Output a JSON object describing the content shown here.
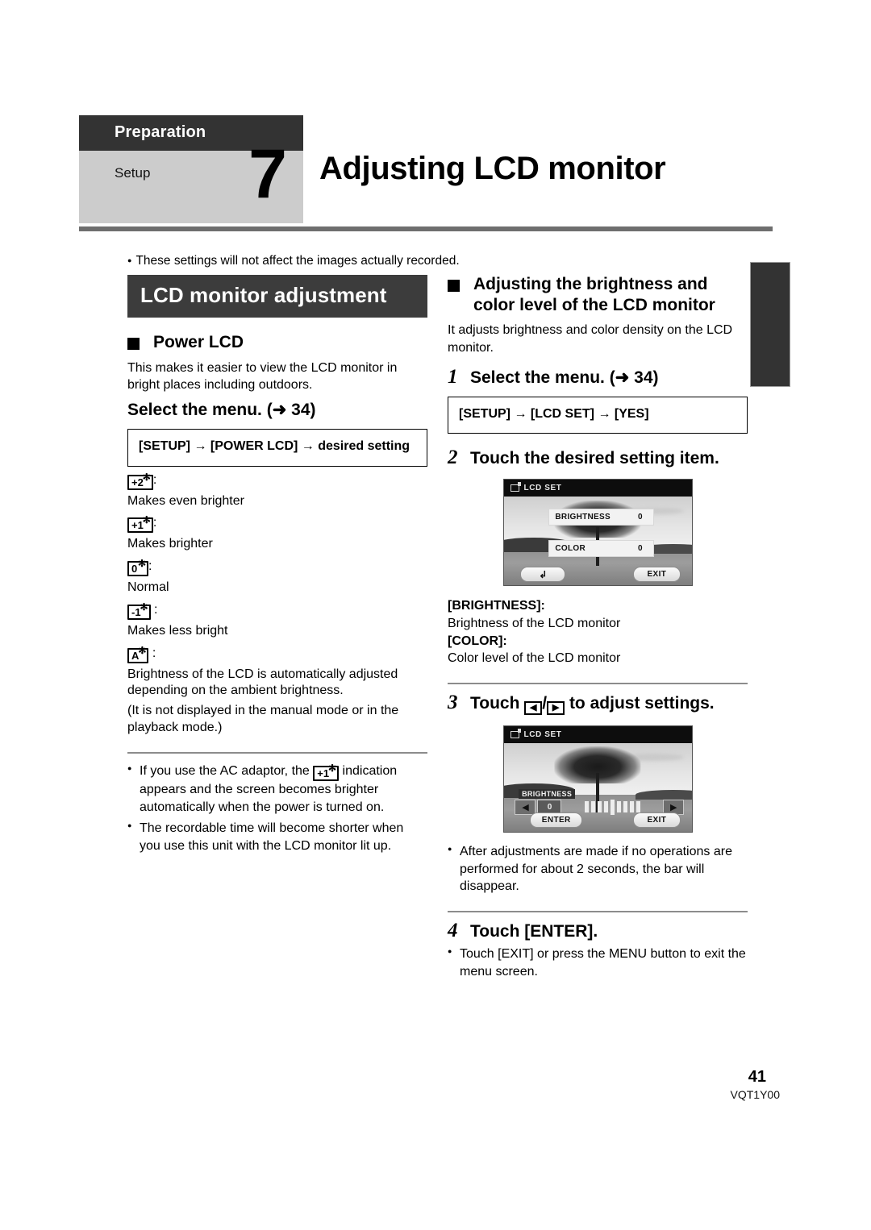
{
  "header": {
    "category": "Preparation",
    "section": "Setup",
    "step_number": "7",
    "title": "Adjusting LCD monitor"
  },
  "top_note": "These settings will not affect the images actually recorded.",
  "left_column": {
    "band_title": "LCD monitor adjustment",
    "power_lcd": {
      "heading": "Power LCD",
      "description": "This makes it easier to view the LCD monitor in bright places including outdoors.",
      "select_menu": "Select the menu. (➜ 34)",
      "menu_path": "[SETUP] → [POWER LCD] → desired setting",
      "options": [
        {
          "icon": "+2",
          "icon_symbol": "✻",
          "colon": ":",
          "desc": "Makes even brighter"
        },
        {
          "icon": "+1",
          "icon_symbol": "✻",
          "colon": ":",
          "desc": "Makes brighter"
        },
        {
          "icon": "0",
          "icon_symbol": "✻",
          "colon": ":",
          "desc": "Normal"
        },
        {
          "icon": "-1",
          "icon_symbol": "✻",
          "colon": " :",
          "desc": "Makes less bright"
        },
        {
          "icon": "A",
          "icon_symbol": "✻",
          "colon": " :",
          "desc": "Brightness of the LCD is automatically adjusted depending on the ambient brightness."
        }
      ],
      "parenthetical": "(It is not displayed in the manual mode or in the playback mode.)",
      "notes": [
        {
          "pre": "If you use the AC adaptor, the ",
          "icon": "+1",
          "icon_symbol": "✻",
          "post": " indication appears and the screen becomes brighter automatically when the power is turned on."
        },
        {
          "pre": "The recordable time will become shorter when you use this unit with the LCD monitor lit up.",
          "icon": "",
          "icon_symbol": "",
          "post": ""
        }
      ]
    }
  },
  "right_column": {
    "heading": "Adjusting the brightness and color level of the LCD monitor",
    "description": "It adjusts brightness and color density on the LCD monitor.",
    "steps": [
      {
        "num": "1",
        "text": "Select the menu. (➜ 34)"
      },
      {
        "num": "2",
        "text": "Touch the desired setting item."
      },
      {
        "num": "3",
        "text": "Touch ◀ / ▶ to adjust settings."
      },
      {
        "num": "4",
        "text": "Touch [ENTER]."
      }
    ],
    "step3_pre": "Touch ",
    "step3_sep": "/",
    "step3_post": " to adjust settings.",
    "step3_left_glyph": "◀",
    "step3_right_glyph": "▶",
    "menu_path": "[SETUP] → [LCD SET] → [YES]",
    "definitions": [
      {
        "key": "[BRIGHTNESS]:",
        "value": "Brightness of the LCD monitor"
      },
      {
        "key": "[COLOR]:",
        "value": "Color level of the LCD monitor"
      }
    ],
    "note_after_step3": "After adjustments are made if no operations are performed for about 2 seconds, the bar will disappear.",
    "note_after_step4": "Touch [EXIT] or press the MENU button to exit the menu screen."
  },
  "lcd_screen_menu": {
    "titlebar": "LCD SET",
    "titlebar_icon": "lcd-set-icon",
    "rows": [
      {
        "label": "BRIGHTNESS",
        "value": "0"
      },
      {
        "label": "COLOR",
        "value": "0"
      }
    ],
    "back_button": "↲",
    "exit_button": "EXIT"
  },
  "lcd_screen_slider": {
    "titlebar": "LCD SET",
    "titlebar_icon": "lcd-set-icon",
    "slider_label": "BRIGHTNESS",
    "slider_value": "0",
    "left_arrow": "◀",
    "right_arrow": "▶",
    "enter_button": "ENTER",
    "exit_button": "EXIT"
  },
  "footer": {
    "page_number": "41",
    "document_code": "VQT1Y00"
  },
  "colors": {
    "band_dark": "#3c3c3c",
    "header_dark": "#333333",
    "header_gray": "#cccccc",
    "rule_gray": "#6e6e6e"
  }
}
